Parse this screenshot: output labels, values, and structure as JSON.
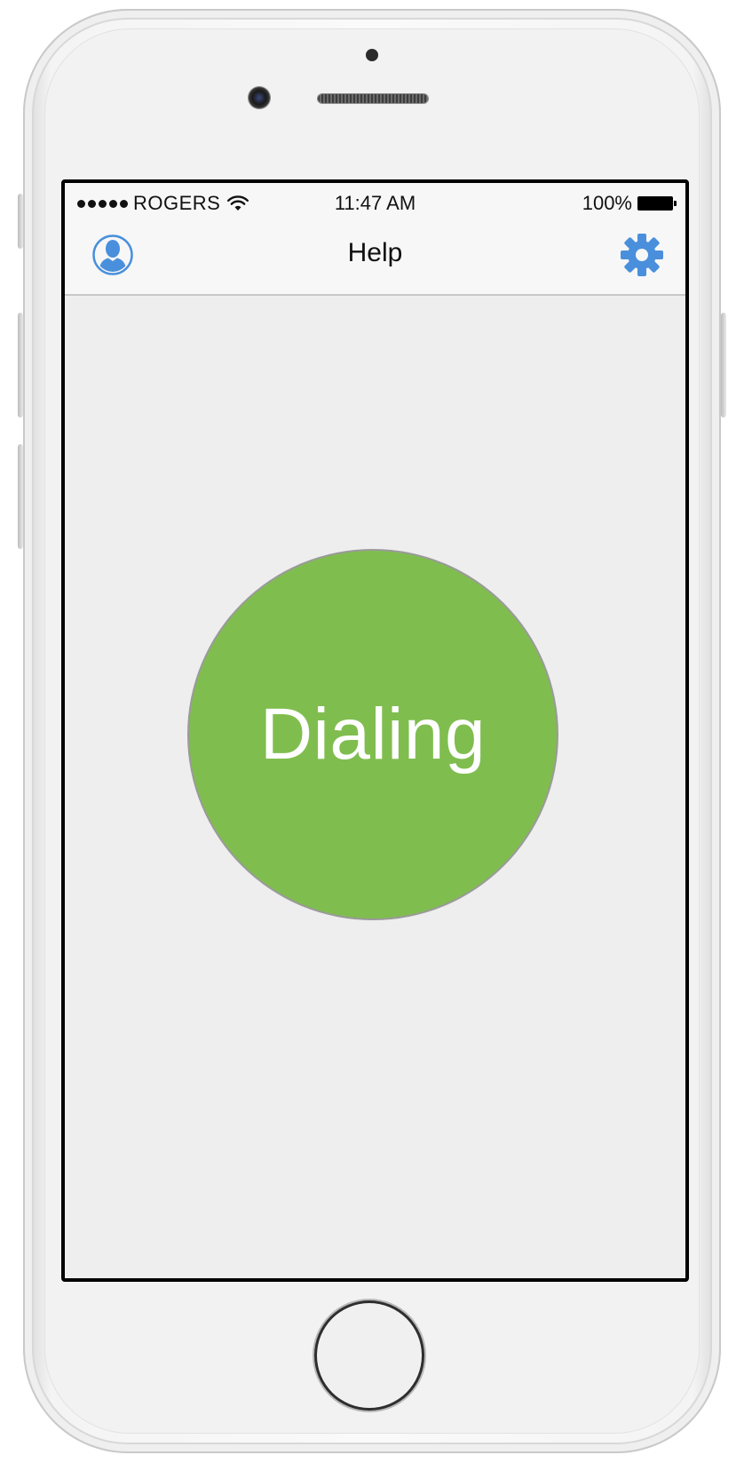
{
  "status_bar": {
    "carrier": "ROGERS",
    "time": "11:47 AM",
    "battery": "100%"
  },
  "nav": {
    "title": "Help",
    "left_icon": "profile-icon",
    "right_icon": "gear-icon"
  },
  "main": {
    "button_label": "Dialing"
  },
  "colors": {
    "accent_blue": "#4a8fdc",
    "dial_green": "#80bd4f"
  }
}
